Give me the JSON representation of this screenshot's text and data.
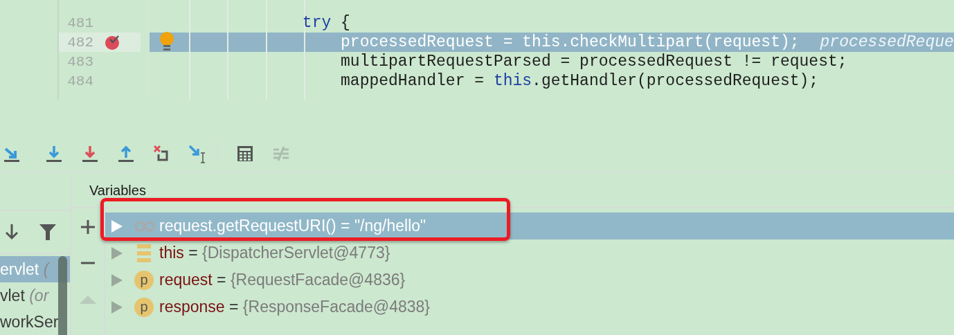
{
  "editor": {
    "lines": [
      {
        "current": false
      },
      {
        "number": "481",
        "current": false,
        "tokens": [
          {
            "text": "                try",
            "kind": "keyword"
          },
          {
            "text": " {",
            "kind": "plain"
          }
        ]
      },
      {
        "number": "482",
        "current": true,
        "breakpoint": true,
        "bulb": true,
        "hint": "processedReque",
        "tokens": [
          {
            "text": "                    processedRequest = this.checkMultipart(request);",
            "kind": "plain"
          }
        ]
      },
      {
        "number": "483",
        "current": false,
        "tokens": [
          {
            "text": "                    multipartRequestParsed = processedRequest != request;",
            "kind": "plain"
          }
        ]
      },
      {
        "number": "484",
        "current": false,
        "tokens": [
          {
            "text": "                    mappedHandler = ",
            "kind": "plain"
          },
          {
            "text": "this",
            "kind": "keyword"
          },
          {
            "text": ".getHandler(processedRequest);",
            "kind": "plain"
          }
        ]
      },
      {
        "current": false
      }
    ]
  },
  "toolbar": {
    "groups": [
      [
        {
          "kind": "step-over",
          "disabled": false
        },
        {
          "kind": "step-into",
          "disabled": false
        },
        {
          "kind": "force-step-into",
          "disabled": false
        },
        {
          "kind": "step-out",
          "disabled": false
        },
        {
          "kind": "drop-frame",
          "disabled": false
        },
        {
          "kind": "run-to-cursor",
          "disabled": false
        }
      ],
      [
        {
          "kind": "evaluate",
          "disabled": false
        },
        {
          "kind": "trace",
          "disabled": true
        }
      ]
    ]
  },
  "frames": {
    "items": [
      {
        "label": "ervlet *(*",
        "selected": true
      },
      {
        "label": "vlet *(or*",
        "selected": false
      },
      {
        "label": "workSer",
        "selected": false
      }
    ]
  },
  "variables": {
    "title": "Variables",
    "items": [
      {
        "kind": "watch",
        "name": "request.getRequestURI()",
        "operator": "=",
        "value": "\"/ng/hello\"",
        "selected": true,
        "highlighted": true
      },
      {
        "kind": "field",
        "name": "this",
        "operator": "=",
        "value": "{DispatcherServlet@4773}",
        "selected": false
      },
      {
        "kind": "param",
        "badge": "p",
        "name": "request",
        "operator": "=",
        "value": "{RequestFacade@4836}",
        "selected": false
      },
      {
        "kind": "param",
        "badge": "p",
        "name": "response",
        "operator": "=",
        "value": "{ResponseFacade@4838}",
        "selected": false
      }
    ]
  }
}
